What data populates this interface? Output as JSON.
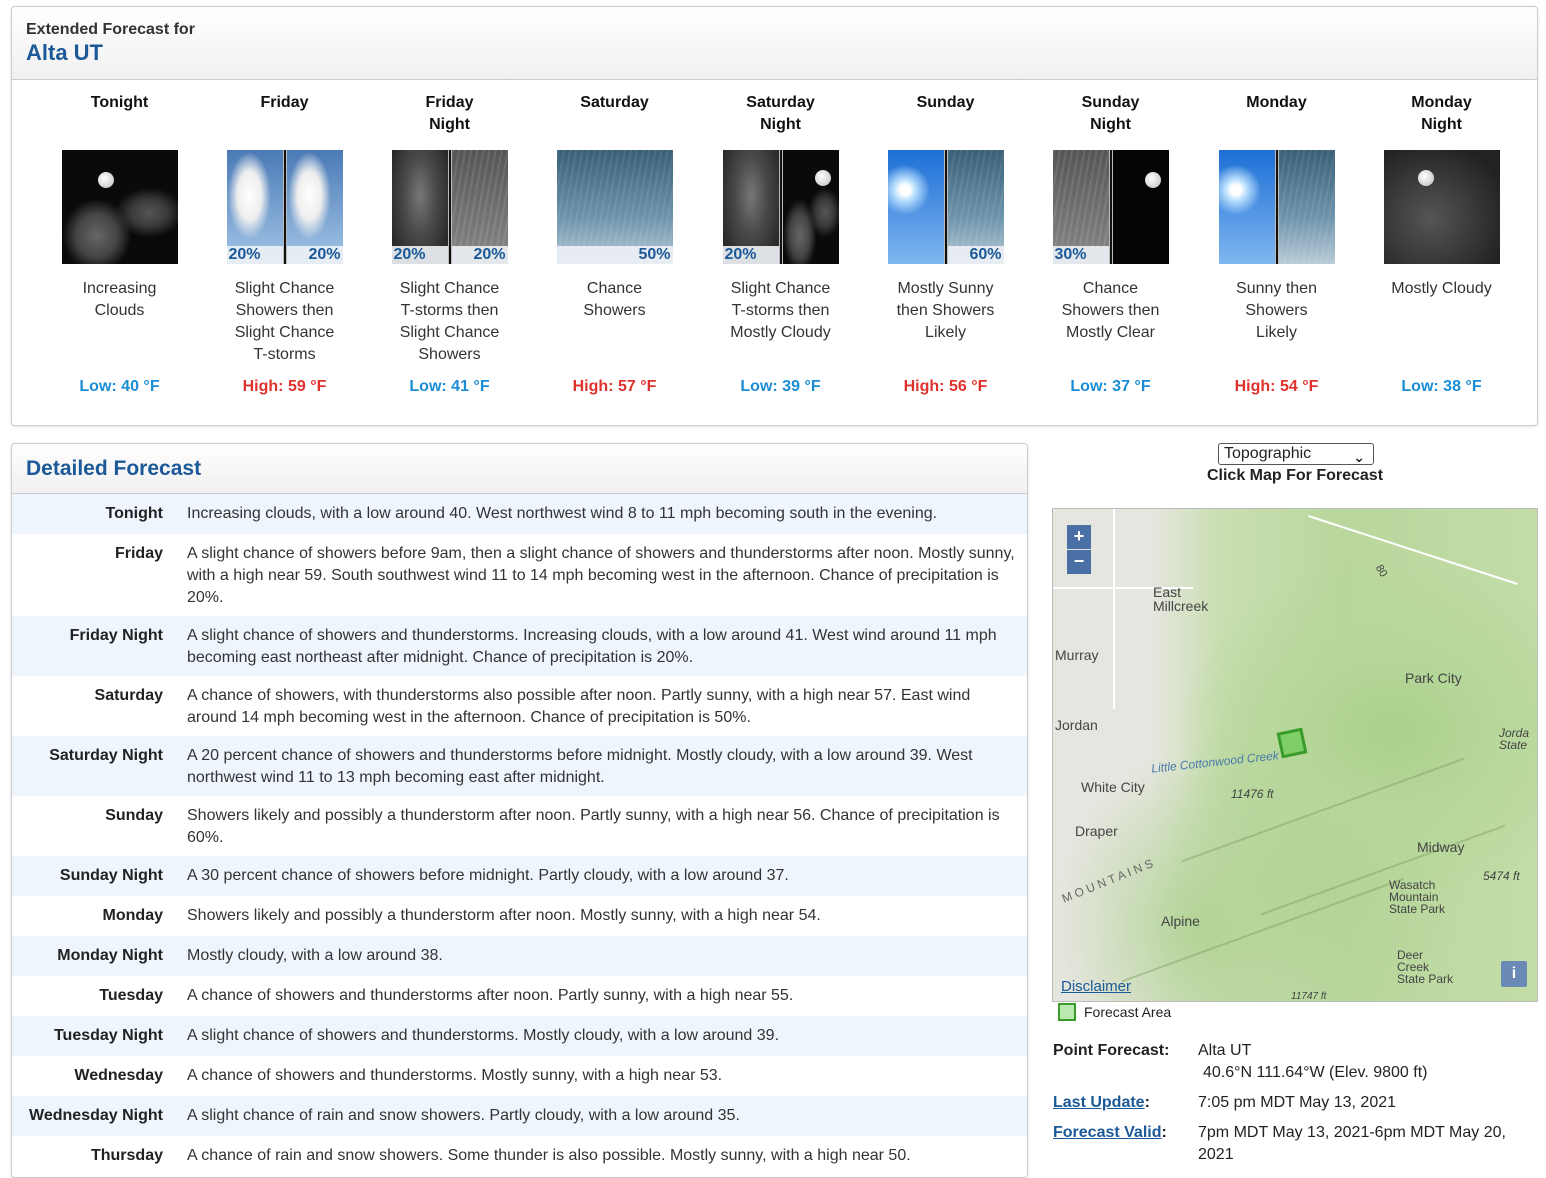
{
  "extended": {
    "title_small": "Extended Forecast for",
    "location": "Alta UT",
    "periods": [
      {
        "name_line1": "Tonight",
        "name_line2": "",
        "desc": [
          "Increasing",
          "Clouds"
        ],
        "temp": "Low: 40 °F",
        "kind": "low",
        "pct_left": "",
        "pct_right": "",
        "icon": "night-partly-cloudy-icon"
      },
      {
        "name_line1": "Friday",
        "name_line2": "",
        "desc": [
          "Slight Chance",
          "Showers then",
          "Slight Chance",
          "T-storms"
        ],
        "temp": "High: 59 °F",
        "kind": "high",
        "pct_left": "20%",
        "pct_right": "20%",
        "icon": "showers-then-tstorms-icon"
      },
      {
        "name_line1": "Friday",
        "name_line2": "Night",
        "desc": [
          "Slight Chance",
          "T-storms then",
          "Slight Chance",
          "Showers"
        ],
        "temp": "Low: 41 °F",
        "kind": "low",
        "pct_left": "20%",
        "pct_right": "20%",
        "icon": "tstorms-then-showers-icon"
      },
      {
        "name_line1": "Saturday",
        "name_line2": "",
        "desc": [
          "Chance",
          "Showers"
        ],
        "temp": "High: 57 °F",
        "kind": "high",
        "pct_left": "",
        "pct_right": "50%",
        "icon": "showers-icon"
      },
      {
        "name_line1": "Saturday",
        "name_line2": "Night",
        "desc": [
          "Slight Chance",
          "T-storms then",
          "Mostly Cloudy"
        ],
        "temp": "Low: 39 °F",
        "kind": "low",
        "pct_left": "20%",
        "pct_right": "",
        "icon": "tstorms-then-cloudy-icon"
      },
      {
        "name_line1": "Sunday",
        "name_line2": "",
        "desc": [
          "Mostly Sunny",
          "then Showers",
          "Likely"
        ],
        "temp": "High: 56 °F",
        "kind": "high",
        "pct_left": "",
        "pct_right": "60%",
        "icon": "sunny-then-showers-icon"
      },
      {
        "name_line1": "Sunday",
        "name_line2": "Night",
        "desc": [
          "Chance",
          "Showers then",
          "Mostly Clear"
        ],
        "temp": "Low: 37 °F",
        "kind": "low",
        "pct_left": "30%",
        "pct_right": "",
        "icon": "showers-then-clear-icon"
      },
      {
        "name_line1": "Monday",
        "name_line2": "",
        "desc": [
          "Sunny then",
          "Showers",
          "Likely"
        ],
        "temp": "High: 54 °F",
        "kind": "high",
        "pct_left": "",
        "pct_right": "",
        "icon": "sunny-then-showers-icon"
      },
      {
        "name_line1": "Monday",
        "name_line2": "Night",
        "desc": [
          "Mostly Cloudy"
        ],
        "temp": "Low: 38 °F",
        "kind": "low",
        "pct_left": "",
        "pct_right": "",
        "icon": "night-mostly-cloudy-icon"
      }
    ]
  },
  "detailed": {
    "title": "Detailed Forecast",
    "rows": [
      {
        "label": "Tonight",
        "text": "Increasing clouds, with a low around 40. West northwest wind 8 to 11 mph becoming south in the evening."
      },
      {
        "label": "Friday",
        "text": "A slight chance of showers before 9am, then a slight chance of showers and thunderstorms after noon. Mostly sunny, with a high near 59. South southwest wind 11 to 14 mph becoming west in the afternoon. Chance of precipitation is 20%."
      },
      {
        "label": "Friday Night",
        "text": "A slight chance of showers and thunderstorms. Increasing clouds, with a low around 41. West wind around 11 mph becoming east northeast after midnight. Chance of precipitation is 20%."
      },
      {
        "label": "Saturday",
        "text": "A chance of showers, with thunderstorms also possible after noon. Partly sunny, with a high near 57. East wind around 14 mph becoming west in the afternoon. Chance of precipitation is 50%."
      },
      {
        "label": "Saturday Night",
        "text": "A 20 percent chance of showers and thunderstorms before midnight. Mostly cloudy, with a low around 39. West northwest wind 11 to 13 mph becoming east after midnight."
      },
      {
        "label": "Sunday",
        "text": "Showers likely and possibly a thunderstorm after noon. Partly sunny, with a high near 56. Chance of precipitation is 60%."
      },
      {
        "label": "Sunday Night",
        "text": "A 30 percent chance of showers before midnight. Partly cloudy, with a low around 37."
      },
      {
        "label": "Monday",
        "text": "Showers likely and possibly a thunderstorm after noon. Mostly sunny, with a high near 54."
      },
      {
        "label": "Monday Night",
        "text": "Mostly cloudy, with a low around 38."
      },
      {
        "label": "Tuesday",
        "text": "A chance of showers and thunderstorms after noon. Partly sunny, with a high near 55."
      },
      {
        "label": "Tuesday Night",
        "text": "A slight chance of showers and thunderstorms. Mostly cloudy, with a low around 39."
      },
      {
        "label": "Wednesday",
        "text": "A chance of showers and thunderstorms. Mostly sunny, with a high near 53."
      },
      {
        "label": "Wednesday Night",
        "text": "A slight chance of rain and snow showers. Partly cloudy, with a low around 35."
      },
      {
        "label": "Thursday",
        "text": "A chance of rain and snow showers. Some thunder is also possible. Mostly sunny, with a high near 50."
      }
    ]
  },
  "map": {
    "select_value": "Topographic",
    "click_label": "Click Map For Forecast",
    "zoom_in": "+",
    "zoom_out": "−",
    "disclaimer": "Disclaimer",
    "info": "i",
    "legend": "Forecast Area",
    "labels": {
      "east_millcreek": "East\nMillcreek",
      "murray": "Murray",
      "park_city": "Park City",
      "jordan": "Jordan",
      "jordanelle": "Jorda\nState",
      "white_city": "White City",
      "little_cottonwood": "Little Cottonwood Creek",
      "elev_11476": "11476 ft",
      "draper": "Draper",
      "midway": "Midway",
      "elev_5474": "5474 ft",
      "wasatch": "Wasatch\nMountain\nState Park",
      "mountains": "M O U N T A I N S",
      "alpine": "Alpine",
      "deer_creek": "Deer\nCreek\nState Park",
      "hwy_80": "80",
      "elev_11747": "11747 ft"
    }
  },
  "point": {
    "label": "Point Forecast:",
    "name": "Alta UT",
    "coords": "40.6°N 111.64°W (Elev. 9800 ft)",
    "last_update_label": "Last Update",
    "last_update_value": "7:05 pm MDT May 13, 2021",
    "valid_label": "Forecast Valid",
    "valid_value": "7pm MDT May 13, 2021-6pm MDT May 20, 2021"
  },
  "colors": {
    "accent": "#1c5998",
    "low": "#1a8dd4",
    "high": "#e0322d",
    "alt_row": "#eef5fc"
  }
}
